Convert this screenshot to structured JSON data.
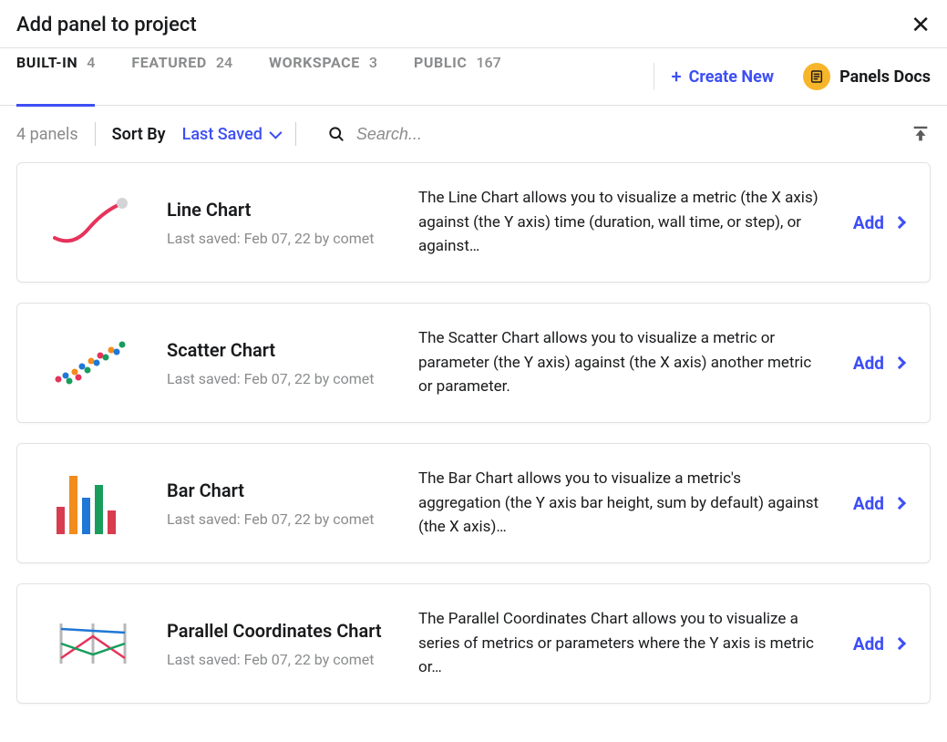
{
  "header": {
    "title": "Add panel to project"
  },
  "tabs": [
    {
      "label": "BUILT-IN",
      "count": "4",
      "active": true
    },
    {
      "label": "FEATURED",
      "count": "24",
      "active": false
    },
    {
      "label": "WORKSPACE",
      "count": "3",
      "active": false
    },
    {
      "label": "PUBLIC",
      "count": "167",
      "active": false
    }
  ],
  "create_new_label": "Create New",
  "docs_label": "Panels Docs",
  "filter": {
    "panel_count_text": "4 panels",
    "sort_by_label": "Sort By",
    "sort_value": "Last Saved",
    "search_placeholder": "Search..."
  },
  "panels": [
    {
      "name": "Line Chart",
      "saved": "Last saved: Feb 07, 22 by comet",
      "desc": "The Line Chart allows you to visualize a metric (the X axis) against (the Y axis) time (duration, wall time, or step), or against…",
      "add_label": "Add"
    },
    {
      "name": "Scatter Chart",
      "saved": "Last saved: Feb 07, 22 by comet",
      "desc": "The Scatter Chart allows you to visualize a metric or parameter (the Y axis) against (the X axis) another metric or parameter.",
      "add_label": "Add"
    },
    {
      "name": "Bar Chart",
      "saved": "Last saved: Feb 07, 22 by comet",
      "desc": "The Bar Chart allows you to visualize a metric's aggregation (the Y axis bar height, sum by default) against (the X axis)…",
      "add_label": "Add"
    },
    {
      "name": "Parallel Coordinates Chart",
      "saved": "Last saved: Feb 07, 22 by comet",
      "desc": "The Parallel Coordinates Chart allows you to visualize a series of metrics or parameters where the Y axis is metric or…",
      "add_label": "Add"
    }
  ]
}
